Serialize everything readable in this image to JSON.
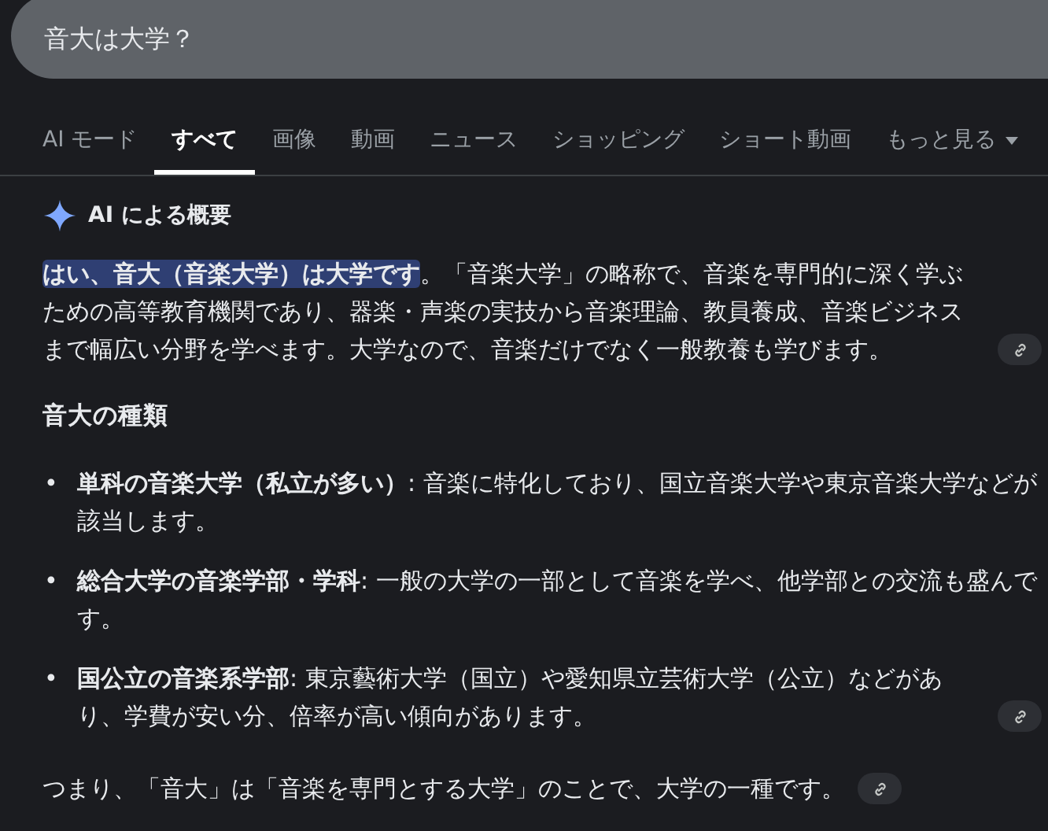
{
  "search": {
    "value": "音大は大学？"
  },
  "tabs": [
    {
      "label": "AI モード",
      "selected": false
    },
    {
      "label": "すべて",
      "selected": true
    },
    {
      "label": "画像",
      "selected": false
    },
    {
      "label": "動画",
      "selected": false
    },
    {
      "label": "ニュース",
      "selected": false
    },
    {
      "label": "ショッピング",
      "selected": false
    },
    {
      "label": "ショート動画",
      "selected": false
    },
    {
      "label": "もっと見る",
      "selected": false,
      "kind": "menu"
    }
  ],
  "overview": {
    "title": "AI による概要",
    "intro": {
      "text": "**はい、音大（音楽大学）は大学です**。「音楽大学」の略称で、音楽を専門的に深く学ぶための高等教育機関であり、器楽・声楽の実技から音楽理論、教員養成、音楽ビジネスまで幅広い分野を学べます。大学なので、音楽だけでなく一般教養も学びます。",
      "link": true
    },
    "heading": "音大の種類",
    "items": [
      {
        "marker": "•",
        "text": "**単科の音楽大学（私立が多い）**: 音楽に特化しており、国立音楽大学や東京音楽大学などが該当します。",
        "link": false
      },
      {
        "marker": "•",
        "text": "**総合大学の音楽学部・学科**: 一般の大学の一部として音楽を学べ、他学部との交流も盛んです。",
        "link": false
      },
      {
        "marker": "•",
        "text": "**国公立の音楽系学部**: 東京藝術大学（国立）や愛知県立芸術大学（公立）などがあり、学費が安い分、倍率が高い傾向があります。",
        "link": true
      }
    ],
    "summary": {
      "text": "つまり、「音大」は「音楽を専門とする大学」のことで、大学の一種です。",
      "link": true
    }
  }
}
